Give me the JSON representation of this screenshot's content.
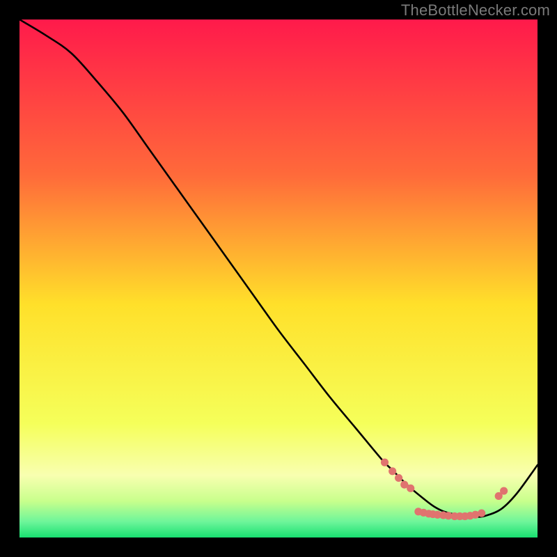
{
  "watermark": "TheBottleNecker.com",
  "colors": {
    "bg": "#000000",
    "watermark": "#7a7a7a",
    "gradient_top": "#ff1a4b",
    "gradient_mid1": "#ff8b2a",
    "gradient_mid2": "#ffe02a",
    "gradient_mid3": "#f5ff5a",
    "gradient_mid4": "#c8ff8c",
    "gradient_bottom": "#18e070",
    "curve": "#000000",
    "marker": "#e0736f"
  },
  "chart_data": {
    "type": "line",
    "title": "",
    "xlabel": "",
    "ylabel": "",
    "xlim": [
      0,
      100
    ],
    "ylim": [
      0,
      100
    ],
    "x": [
      0,
      5,
      10,
      15,
      20,
      25,
      30,
      35,
      40,
      45,
      50,
      55,
      60,
      65,
      70,
      72,
      75,
      78,
      80,
      82,
      85,
      88,
      90,
      93,
      96,
      100
    ],
    "y": [
      100,
      97,
      93.5,
      88,
      82,
      75,
      68,
      61,
      54,
      47,
      40,
      33.5,
      27,
      21,
      15,
      13,
      10,
      7.5,
      6,
      5,
      4.3,
      4,
      4.2,
      5.5,
      8.5,
      14
    ],
    "markers": [
      {
        "x": 70.5,
        "y": 14.5
      },
      {
        "x": 72.0,
        "y": 12.8
      },
      {
        "x": 73.2,
        "y": 11.5
      },
      {
        "x": 74.3,
        "y": 10.2
      },
      {
        "x": 75.5,
        "y": 9.5
      },
      {
        "x": 77.0,
        "y": 5.0
      },
      {
        "x": 78.0,
        "y": 4.8
      },
      {
        "x": 79.0,
        "y": 4.6
      },
      {
        "x": 79.8,
        "y": 4.5
      },
      {
        "x": 80.7,
        "y": 4.4
      },
      {
        "x": 81.8,
        "y": 4.3
      },
      {
        "x": 82.8,
        "y": 4.2
      },
      {
        "x": 84.0,
        "y": 4.1
      },
      {
        "x": 85.0,
        "y": 4.1
      },
      {
        "x": 86.0,
        "y": 4.1
      },
      {
        "x": 87.0,
        "y": 4.2
      },
      {
        "x": 88.0,
        "y": 4.4
      },
      {
        "x": 89.2,
        "y": 4.7
      },
      {
        "x": 92.5,
        "y": 8.0
      },
      {
        "x": 93.5,
        "y": 9.0
      }
    ]
  }
}
